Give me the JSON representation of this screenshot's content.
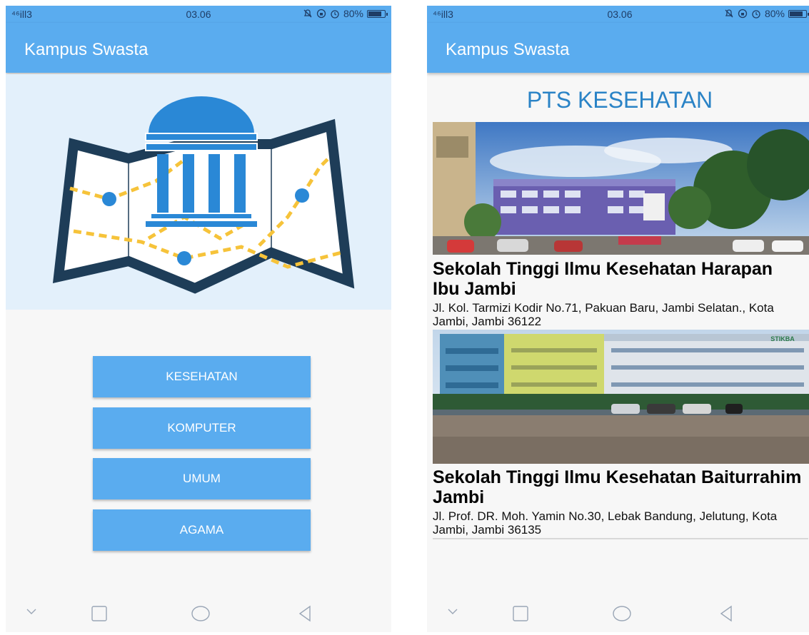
{
  "left_screen": {
    "status": {
      "signal": "⁴⁶ill3",
      "time": "03.06",
      "battery": "80%",
      "battery_level": 0.8
    },
    "app_title": "Kampus Swasta",
    "menu": [
      {
        "label": "KESEHATAN"
      },
      {
        "label": "KOMPUTER"
      },
      {
        "label": "UMUM"
      },
      {
        "label": "AGAMA"
      }
    ]
  },
  "right_screen": {
    "status": {
      "signal": "⁴⁶ill3",
      "time": "03.06",
      "battery": "80%",
      "battery_level": 0.8
    },
    "app_title": "Kampus Swasta",
    "heading": "PTS KESEHATAN",
    "entries": [
      {
        "name": "Sekolah Tinggi Ilmu Kesehatan Harapan Ibu Jambi",
        "address": "Jl. Kol. Tarmizi Kodir No.71, Pakuan Baru, Jambi Selatan., Kota Jambi, Jambi 36122"
      },
      {
        "name": "Sekolah Tinggi Ilmu Kesehatan Baiturrahim Jambi",
        "address": "Jl. Prof. DR. Moh. Yamin  No.30, Lebak Bandung, Jelutung, Kota Jambi, Jambi 36135",
        "sign_text": "STIKBA"
      }
    ]
  },
  "icons": {
    "status": [
      "signal-icon",
      "bell-off-icon",
      "lock-rotation-icon",
      "alarm-icon",
      "battery-icon"
    ],
    "hero": "campus-map-icon",
    "nav": [
      "chevron-down-icon",
      "square-icon",
      "circle-icon",
      "back-triangle-icon"
    ]
  },
  "colors": {
    "primary": "#5aacef",
    "hero_bg": "#e3f0fb",
    "heading": "#2a83c6",
    "map_frame": "#1e3d58",
    "map_route": "#f6c33a"
  }
}
